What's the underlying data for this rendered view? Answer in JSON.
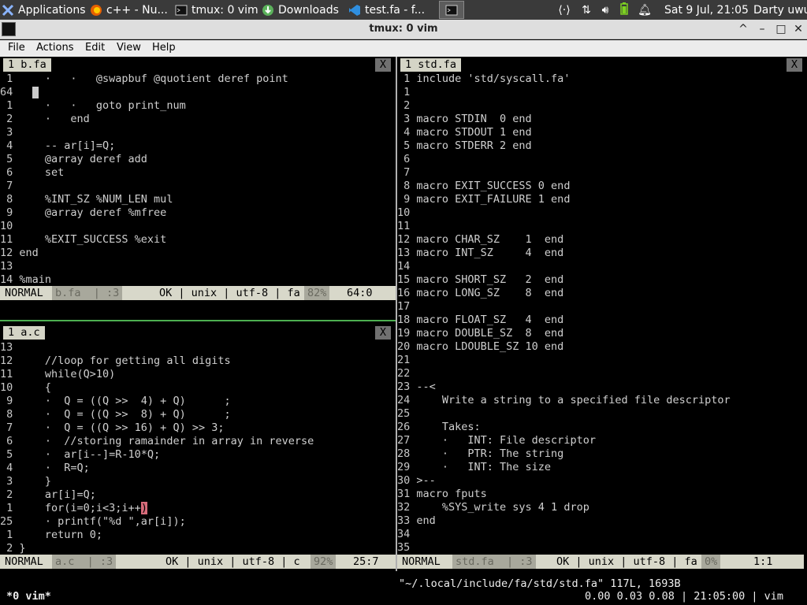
{
  "panel": {
    "tasks": [
      {
        "label": "Applications",
        "icon": "xfce-icon"
      },
      {
        "label": "c++ - Nu...",
        "icon": "firefox-icon"
      },
      {
        "label": "tmux: 0 vim",
        "icon": "terminal-icon"
      },
      {
        "label": "Downloads",
        "icon": "download-icon"
      },
      {
        "label": "test.fa - f...",
        "icon": "vscode-icon"
      },
      {
        "label": "",
        "icon": "terminal-icon"
      }
    ],
    "tray_icons": [
      "network-icon",
      "transfer-icon",
      "volume-icon",
      "battery-icon",
      "bell-icon"
    ],
    "clock": "Sat  9 Jul, 21:05",
    "user": "Darty uwu"
  },
  "window": {
    "title": "tmux: 0 vim",
    "controls": [
      "^",
      "–",
      "□",
      "✕"
    ]
  },
  "menu": [
    "File",
    "Actions",
    "Edit",
    "View",
    "Help"
  ],
  "panes": {
    "top_left": {
      "tab": "1 b.fa",
      "close": "X",
      "lines": [
        {
          "n": "1",
          "t": "    ·   ·   @swapbuf @quotient deref point"
        },
        {
          "n": "64",
          "t": "  ",
          "cursor": true
        },
        {
          "n": "1",
          "t": "    ·   ·   goto print_num"
        },
        {
          "n": "2",
          "t": "    ·   end"
        },
        {
          "n": "3",
          "t": ""
        },
        {
          "n": "4",
          "t": "    -- ar[i]=Q;"
        },
        {
          "n": "5",
          "t": "    @array deref add"
        },
        {
          "n": "6",
          "t": "    set"
        },
        {
          "n": "7",
          "t": ""
        },
        {
          "n": "8",
          "t": "    %INT_SZ %NUM_LEN mul"
        },
        {
          "n": "9",
          "t": "    @array deref %mfree"
        },
        {
          "n": "10",
          "t": ""
        },
        {
          "n": "11",
          "t": "    %EXIT_SUCCESS %exit"
        },
        {
          "n": "12",
          "t": "end"
        },
        {
          "n": "13",
          "t": ""
        },
        {
          "n": "14",
          "t": "%main"
        }
      ],
      "status": {
        "mode": "NORMAL",
        "file": "b.fa  | :3",
        "info": "OK | unix | utf-8 | fa",
        "pct": "82%",
        "pos": "64:0"
      }
    },
    "bottom_left": {
      "tab": "1 a.c",
      "close": "X",
      "lines": [
        {
          "n": "13",
          "t": ""
        },
        {
          "n": "12",
          "t": "    //loop for getting all digits"
        },
        {
          "n": "11",
          "t": "    while(Q>10)"
        },
        {
          "n": "10",
          "t": "    {"
        },
        {
          "n": "9",
          "t": "    ·  Q = ((Q >>  4) + Q)      ;"
        },
        {
          "n": "8",
          "t": "    ·  Q = ((Q >>  8) + Q)      ;"
        },
        {
          "n": "7",
          "t": "    ·  Q = ((Q >> 16) + Q) >> 3;"
        },
        {
          "n": "6",
          "t": "    ·  //storing ramainder in array in reverse"
        },
        {
          "n": "5",
          "t": "    ·  ar[i--]=R-10*Q;"
        },
        {
          "n": "4",
          "t": "    ·  R=Q;"
        },
        {
          "n": "3",
          "t": "    }"
        },
        {
          "n": "2",
          "t": "    ar[i]=Q;"
        },
        {
          "n": "1",
          "t": "    for(i=0;i<3;i++",
          "close_paren": ")"
        },
        {
          "n": "25",
          "t": "    · printf(\"%d \",ar[i]);"
        },
        {
          "n": "1",
          "t": "    return 0;"
        },
        {
          "n": "2",
          "t": "}"
        }
      ],
      "status": {
        "mode": "NORMAL",
        "file": "a.c  | :3",
        "info": "OK | unix | utf-8 | c",
        "pct": "92%",
        "pos": "25:7"
      }
    },
    "right": {
      "tab": "1 std.fa",
      "close": "X",
      "lines": [
        {
          "n": "1",
          "t": "include 'std/syscall.fa'"
        },
        {
          "n": "1",
          "t": ""
        },
        {
          "n": "2",
          "t": ""
        },
        {
          "n": "3",
          "t": "macro STDIN  0 end"
        },
        {
          "n": "4",
          "t": "macro STDOUT 1 end"
        },
        {
          "n": "5",
          "t": "macro STDERR 2 end"
        },
        {
          "n": "6",
          "t": ""
        },
        {
          "n": "7",
          "t": ""
        },
        {
          "n": "8",
          "t": "macro EXIT_SUCCESS 0 end"
        },
        {
          "n": "9",
          "t": "macro EXIT_FAILURE 1 end"
        },
        {
          "n": "10",
          "t": ""
        },
        {
          "n": "11",
          "t": ""
        },
        {
          "n": "12",
          "t": "macro CHAR_SZ    1  end"
        },
        {
          "n": "13",
          "t": "macro INT_SZ     4  end"
        },
        {
          "n": "14",
          "t": ""
        },
        {
          "n": "15",
          "t": "macro SHORT_SZ   2  end"
        },
        {
          "n": "16",
          "t": "macro LONG_SZ    8  end"
        },
        {
          "n": "17",
          "t": ""
        },
        {
          "n": "18",
          "t": "macro FLOAT_SZ   4  end"
        },
        {
          "n": "19",
          "t": "macro DOUBLE_SZ  8  end"
        },
        {
          "n": "20",
          "t": "macro LDOUBLE_SZ 10 end"
        },
        {
          "n": "21",
          "t": ""
        },
        {
          "n": "22",
          "t": ""
        },
        {
          "n": "23",
          "t": "--<"
        },
        {
          "n": "24",
          "t": "    Write a string to a specified file descriptor"
        },
        {
          "n": "25",
          "t": ""
        },
        {
          "n": "26",
          "t": "    Takes:"
        },
        {
          "n": "27",
          "t": "    ·   INT: File descriptor"
        },
        {
          "n": "28",
          "t": "    ·   PTR: The string"
        },
        {
          "n": "29",
          "t": "    ·   INT: The size"
        },
        {
          "n": "30",
          "t": ">--"
        },
        {
          "n": "31",
          "t": "macro fputs"
        },
        {
          "n": "32",
          "t": "    %SYS_write sys 4 1 drop"
        },
        {
          "n": "33",
          "t": "end"
        },
        {
          "n": "34",
          "t": ""
        },
        {
          "n": "35",
          "t": ""
        }
      ],
      "status": {
        "mode": "NORMAL",
        "file": "std.fa  | :3",
        "info": "OK | unix | utf-8 | fa",
        "pct": "0%",
        "pos": "1:1"
      }
    }
  },
  "tmux": {
    "message": "\"~/.local/include/fa/std/std.fa\" 117L, 1693B",
    "window": "*0 vim*",
    "right": "0.00 0.03 0.08 | 21:05:00 | vim"
  },
  "colors": {
    "panel_bg": "#3a3a3a",
    "titlebar_bg": "#dedede",
    "statusline_bg": "#d8d8ca",
    "divider_green": "#4caf50",
    "match_paren": "#d76b7a"
  }
}
